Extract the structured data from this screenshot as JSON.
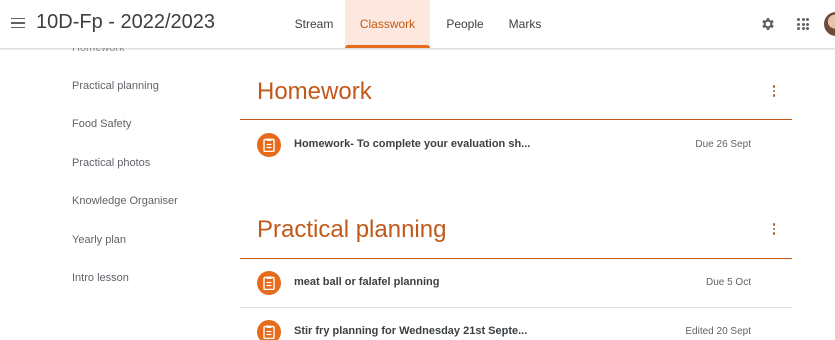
{
  "header": {
    "class_title": "10D-Fp - 2022/2023",
    "tabs": [
      {
        "label": "Stream"
      },
      {
        "label": "Classwork"
      },
      {
        "label": "People"
      },
      {
        "label": "Marks"
      }
    ],
    "active_tab": "Classwork"
  },
  "sidebar": {
    "partial_item": "Homework",
    "items": [
      {
        "label": "Practical planning"
      },
      {
        "label": "Food Safety"
      },
      {
        "label": "Practical photos"
      },
      {
        "label": "Knowledge Organiser"
      },
      {
        "label": "Yearly plan"
      },
      {
        "label": "Intro lesson"
      }
    ]
  },
  "topics": [
    {
      "title": "Homework",
      "items": [
        {
          "title": "Homework- To complete your evaluation sh...",
          "status": "Due 26 Sept",
          "icon": "assignment-icon"
        }
      ]
    },
    {
      "title": "Practical planning",
      "items": [
        {
          "title": "meat ball or falafel planning",
          "status": "Due 5 Oct",
          "icon": "assignment-icon"
        },
        {
          "title": "Stir fry planning for Wednesday 21st Septe...",
          "status": "Edited 20 Sept",
          "icon": "assignment-icon"
        }
      ]
    }
  ],
  "colors": {
    "accent": "#e66b1b",
    "accent_text": "#c2591a",
    "active_tab_bg": "#fce8de"
  }
}
